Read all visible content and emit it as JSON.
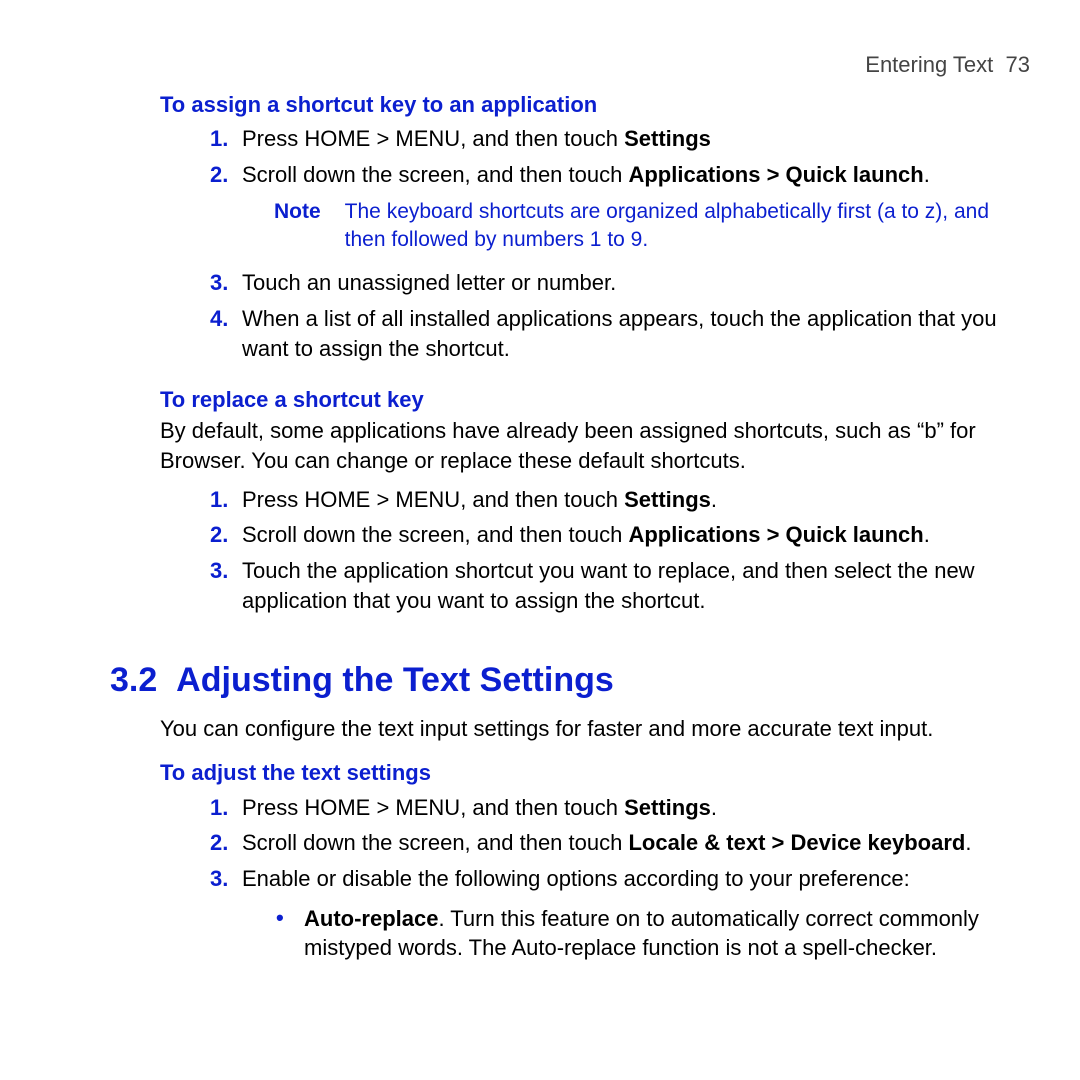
{
  "header": {
    "chapter": "Entering Text",
    "page": "73"
  },
  "sec_a": {
    "title": "To assign a shortcut key to an application",
    "steps": [
      {
        "prefix": "Press HOME > MENU, and then touch ",
        "bold1": "Settings",
        "suffix": ""
      },
      {
        "prefix": "Scroll down the screen, and then touch ",
        "bold1": "Applications > Quick launch",
        "suffix": "."
      },
      {
        "prefix": "Touch an unassigned letter or number.",
        "bold1": "",
        "suffix": ""
      },
      {
        "prefix": "When a list of all installed applications appears, touch the application that you want to assign the shortcut.",
        "bold1": "",
        "suffix": ""
      }
    ],
    "note": {
      "label": "Note",
      "body": "The keyboard shortcuts are organized alphabetically first (a to z), and then followed by numbers 1 to 9."
    }
  },
  "sec_b": {
    "title": "To replace a shortcut key",
    "intro": "By default, some applications have already been assigned shortcuts, such as “b” for Browser. You can change or replace these default shortcuts.",
    "steps": [
      {
        "prefix": "Press HOME > MENU, and then touch ",
        "bold1": "Settings",
        "suffix": "."
      },
      {
        "prefix": "Scroll down the screen, and then touch ",
        "bold1": "Applications > Quick launch",
        "suffix": "."
      },
      {
        "prefix": "Touch the application shortcut you want to replace, and then select the new application that you want to assign the shortcut.",
        "bold1": "",
        "suffix": ""
      }
    ]
  },
  "sec_h": {
    "number": "3.2",
    "title": "Adjusting the Text Settings",
    "intro": "You can configure the text input settings for faster and more accurate text input."
  },
  "sec_c": {
    "title": "To adjust the text settings",
    "steps": [
      {
        "prefix": "Press HOME > MENU, and then touch ",
        "bold1": "Settings",
        "suffix": "."
      },
      {
        "prefix": "Scroll down the screen, and then touch ",
        "bold1": "Locale & text > Device keyboard",
        "suffix": "."
      },
      {
        "prefix": "Enable or disable the following options according to your preference:",
        "bold1": "",
        "suffix": ""
      }
    ],
    "bullets": [
      {
        "bold": "Auto-replace",
        "rest": ". Turn this feature on to automatically correct commonly mistyped words. The Auto-replace function is not a spell-checker."
      }
    ]
  }
}
